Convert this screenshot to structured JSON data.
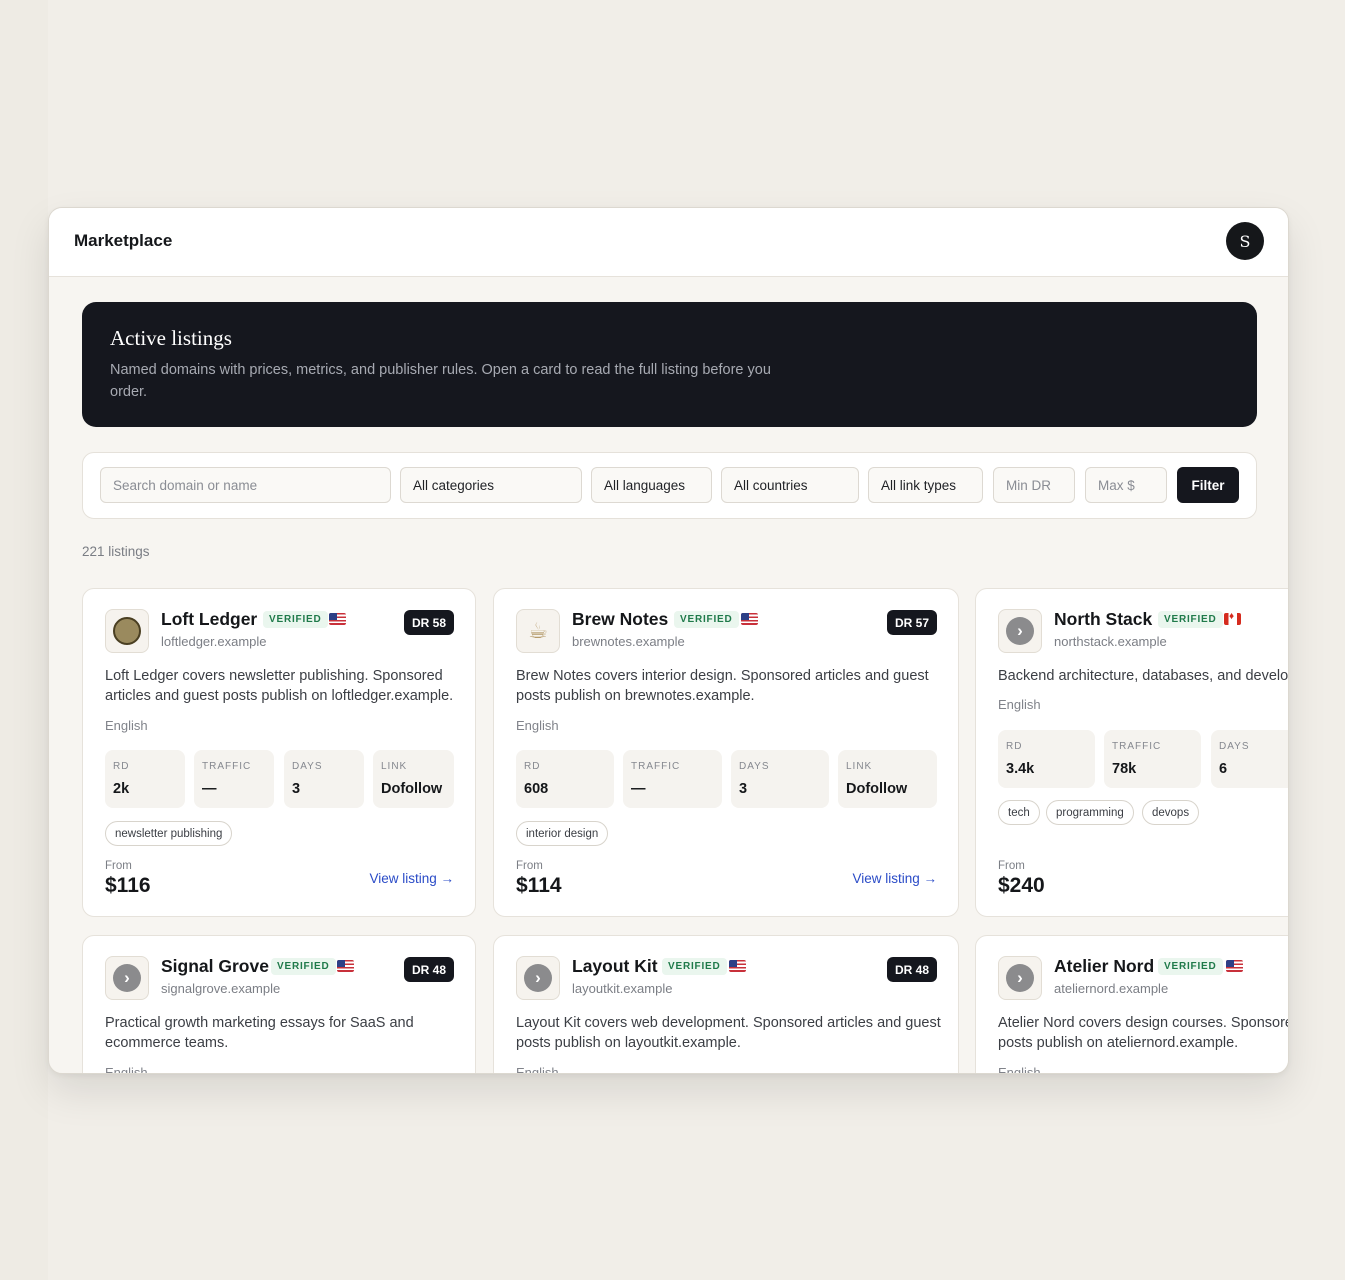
{
  "app": {
    "title": "Marketplace",
    "avatar_initial": "S"
  },
  "hero": {
    "title": "Active listings",
    "description": "Named domains with prices, metrics, and publisher rules. Open a card to read the full listing before you order."
  },
  "filters": {
    "search_placeholder": "Search domain or name",
    "category": "All categories",
    "language": "All languages",
    "country": "All countries",
    "link_type": "All link types",
    "min_dr_placeholder": "Min DR",
    "max_price_placeholder": "Max $",
    "filter_button": "Filter"
  },
  "listing_count": "221 listings",
  "labels": {
    "rd": "RD",
    "traffic": "TRAFFIC",
    "days": "DAYS",
    "link": "LINK",
    "from": "From",
    "view": "View listing →",
    "verified": "VERIFIED"
  },
  "cards": [
    {
      "name": "Loft Ledger",
      "domain": "loftledger.example",
      "dr": "DR 58",
      "flag": "us",
      "desc_line1": "Loft Ledger covers newsletter publishing. Sponsored",
      "desc_line2": "articles and guest posts publish on loftledger.example.",
      "language": "English",
      "rd": "2k",
      "traffic": "—",
      "days": "3",
      "link": "Dofollow",
      "tags": [
        "newsletter publishing"
      ],
      "price": "$116"
    },
    {
      "name": "Brew Notes",
      "domain": "brewnotes.example",
      "dr": "DR 57",
      "flag": "us",
      "desc_line1": "Brew Notes covers interior design. Sponsored articles and guest",
      "desc_line2": "posts publish on brewnotes.example.",
      "language": "English",
      "rd": "608",
      "traffic": "—",
      "days": "3",
      "link": "Dofollow",
      "tags": [
        "interior design"
      ],
      "price": "$114"
    },
    {
      "name": "North Stack",
      "domain": "northstack.example",
      "dr": "",
      "flag": "ca",
      "desc_line1": "Backend architecture, databases, and develop",
      "desc_line2": "",
      "language": "English",
      "rd": "3.4k",
      "traffic": "78k",
      "days": "6",
      "link": "",
      "tags": [
        "tech",
        "programming",
        "devops"
      ],
      "price": "$240"
    },
    {
      "name": "Signal Grove",
      "domain": "signalgrove.example",
      "dr": "DR 48",
      "flag": "us",
      "desc_line1": "Practical growth marketing essays for SaaS and",
      "desc_line2": "ecommerce teams.",
      "language": "English"
    },
    {
      "name": "Layout Kit",
      "domain": "layoutkit.example",
      "dr": "DR 48",
      "flag": "us",
      "desc_line1": "Layout Kit covers web development. Sponsored articles and guest",
      "desc_line2": "posts publish on layoutkit.example.",
      "language": "English"
    },
    {
      "name": "Atelier Nord",
      "domain": "ateliernord.example",
      "dr": "",
      "flag": "us",
      "desc_line1": "Atelier Nord covers design courses. Sponsored",
      "desc_line2": "posts publish on ateliernord.example.",
      "language": "English"
    }
  ]
}
